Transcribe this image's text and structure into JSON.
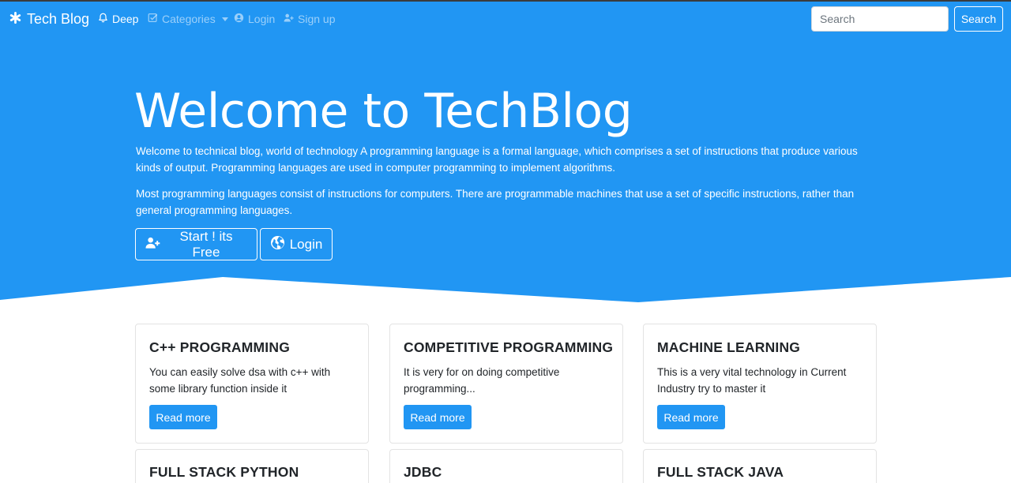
{
  "navbar": {
    "brand": "Tech Blog",
    "items": [
      {
        "label": "Deep",
        "icon": "bell-icon",
        "active": true
      },
      {
        "label": "Categories",
        "icon": "check-square-icon",
        "active": false
      },
      {
        "label": "Login",
        "icon": "user-circle-icon",
        "active": false
      },
      {
        "label": "Sign up",
        "icon": "user-plus-icon",
        "active": false
      }
    ],
    "search_placeholder": "Search",
    "search_button": "Search"
  },
  "hero": {
    "title": "Welcome to TechBlog",
    "paragraph1": "Welcome to technical blog, world of technology A programming language is a formal language, which comprises a set of instructions that produce various kinds of output. Programming languages are used in computer programming to implement algorithms.",
    "paragraph2": "Most programming languages consist of instructions for computers. There are programmable machines that use a set of specific instructions, rather than general programming languages.",
    "start_button": "Start ! its Free",
    "login_button": "Login"
  },
  "cards": [
    {
      "title": "C++ PROGRAMMING",
      "text": "You can easily solve dsa with c++ with some library function inside it",
      "button": "Read more"
    },
    {
      "title": "COMPETITIVE PROGRAMMING",
      "text": "It is very for on doing competitive programming...",
      "button": "Read more"
    },
    {
      "title": "MACHINE LEARNING",
      "text": "This is a very vital technology in Current Industry try to master it",
      "button": "Read more"
    },
    {
      "title": "FULL STACK PYTHON",
      "text": "",
      "button": ""
    },
    {
      "title": "JDBC",
      "text": "",
      "button": ""
    },
    {
      "title": "FULL STACK JAVA PROGRAMME",
      "text": "",
      "button": ""
    }
  ],
  "colors": {
    "primary": "#2196f3",
    "white": "#ffffff",
    "text": "#212529"
  }
}
